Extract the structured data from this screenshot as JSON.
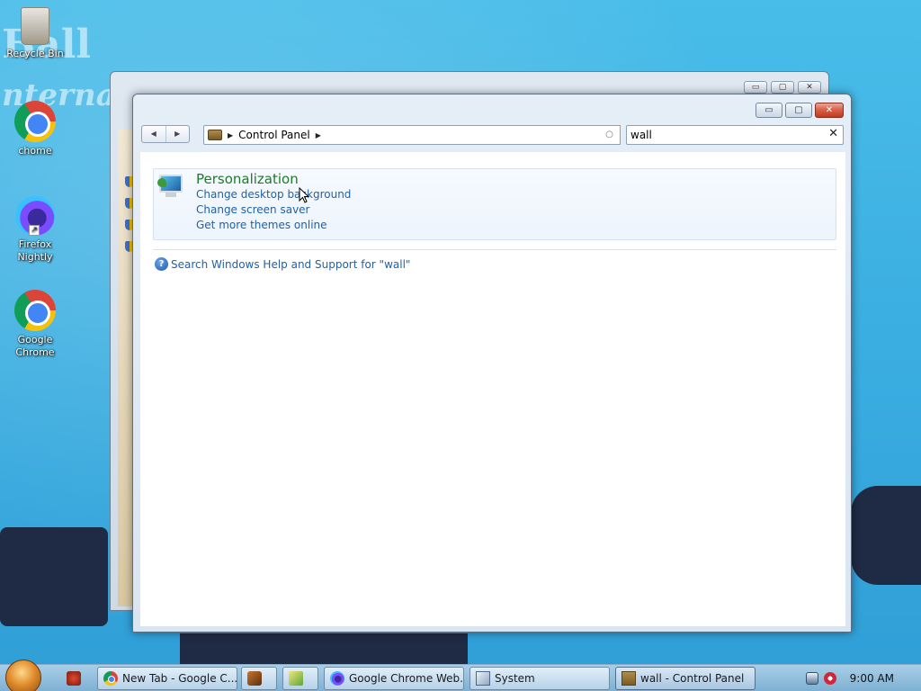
{
  "desktop": {
    "wallpaper_text_1": "Ball",
    "wallpaper_text_2": "nternat",
    "icons": [
      {
        "label": "Recycle Bin",
        "icon": "recycle-bin-icon"
      },
      {
        "label": "chome",
        "icon": "chrome-icon"
      },
      {
        "label": "Firefox Nightly",
        "icon": "firefox-nightly-icon"
      },
      {
        "label": "Google Chrome",
        "icon": "chrome-icon"
      }
    ]
  },
  "window": {
    "title_buttons": {
      "minimize": "▭",
      "maximize": "▢",
      "close": "✕"
    },
    "nav": {
      "back": "◀",
      "forward": "▶"
    },
    "address": {
      "icon": "control-panel-icon",
      "crumb_arrow": "▶",
      "crumb": "Control Panel",
      "dropdown": "▼",
      "refresh": "○"
    },
    "search": {
      "value": "wall",
      "clear": "✕"
    },
    "results": {
      "category": {
        "title": "Personalization",
        "icon": "personalization-icon",
        "links": [
          "Change desktop background",
          "Change screen saver",
          "Get more themes online"
        ]
      },
      "help_icon": "?",
      "help_text": "Search Windows Help and Support for \"wall\""
    }
  },
  "taskbar": {
    "tasks": [
      {
        "label": "New Tab - Google C...",
        "icon": "chrome-icon"
      },
      {
        "label": "Google Chrome Web...",
        "icon": "firefox-nightly-icon"
      },
      {
        "label": "System",
        "icon": "system-icon"
      },
      {
        "label": "wall - Control Panel",
        "icon": "control-panel-icon",
        "active": true
      }
    ],
    "clock": "9:00 AM"
  },
  "colors": {
    "link": "#1f61a8",
    "category_title": "#1e7a2a",
    "close_button": "#c2381e",
    "desktop": "#3fb3e4"
  }
}
